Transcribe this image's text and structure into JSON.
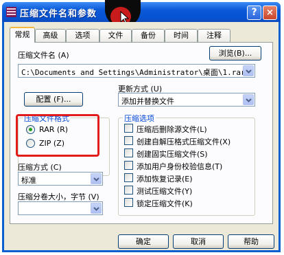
{
  "window": {
    "title": "压缩文件名和参数",
    "help_label": "?",
    "close_label": "×"
  },
  "tabs": [
    {
      "label": "常规",
      "active": true
    },
    {
      "label": "高级"
    },
    {
      "label": "选项"
    },
    {
      "label": "文件"
    },
    {
      "label": "备份"
    },
    {
      "label": "时间"
    },
    {
      "label": "注释"
    }
  ],
  "general": {
    "archive_name_label": "压缩文件名",
    "archive_name_key": "(A)",
    "browse_label": "浏览",
    "browse_key": "(B)...",
    "archive_name_value": "C:\\Documents and Settings\\Administrator\\桌面\\1.rar",
    "update_mode_label": "更新方式",
    "update_mode_key": "(U)",
    "update_mode_value": "添加并替换文件",
    "profiles_label": "配置",
    "profiles_key": "(F)...",
    "format_group_title": "压缩文件格式",
    "format_options": [
      {
        "label": "RAR",
        "key": "(R)",
        "selected": true
      },
      {
        "label": "ZIP",
        "key": "(Z)",
        "selected": false
      }
    ],
    "method_label": "压缩方式",
    "method_key": "(C)",
    "method_value": "标准",
    "split_label": "压缩分卷大小，字节",
    "split_key": "(V)",
    "split_value": "",
    "options_group_title": "压缩选项",
    "options": [
      {
        "label": "压缩后删除源文件",
        "key": "(L)",
        "checked": false
      },
      {
        "label": "创建自解压格式压缩文件",
        "key": "(X)",
        "checked": false
      },
      {
        "label": "创建固实压缩文件",
        "key": "(S)",
        "checked": false
      },
      {
        "label": "添加用户身份校验信息",
        "key": "(T)",
        "checked": false
      },
      {
        "label": "添加恢复记录",
        "key": "(E)",
        "checked": false
      },
      {
        "label": "测试压缩文件",
        "key": "(Y)",
        "checked": false
      },
      {
        "label": "锁定压缩文件",
        "key": "(K)",
        "checked": false
      }
    ]
  },
  "footer": {
    "ok_label": "确定",
    "cancel_label": "取消",
    "help_label": "帮助"
  },
  "colors": {
    "titlebar": "#0a5ad8",
    "group_title": "#0046d5",
    "highlight_box": "#e21b1b",
    "cursor_dot": "#c81c1c"
  }
}
